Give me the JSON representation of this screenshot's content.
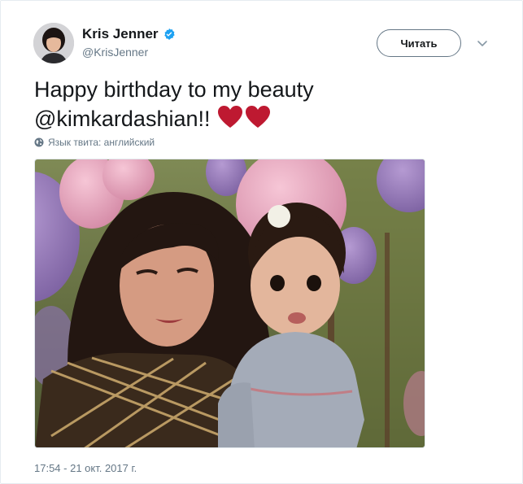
{
  "tweet": {
    "author_name": "Kris Jenner",
    "author_handle": "@KrisJenner",
    "follow_label": "Читать",
    "text": "Happy birthday to my beauty @kimkardashian!!",
    "language_note": "Язык твита: английский",
    "timestamp": "17:54 - 21 окт. 2017 г."
  },
  "icons": {
    "verified": "verified-badge-icon",
    "caret": "chevron-down-icon",
    "globe": "globe-icon",
    "heart": "heart-emoji-icon"
  },
  "colors": {
    "verified_blue": "#1da1f2",
    "heart_red": "#be1931",
    "secondary_text": "#657786"
  }
}
